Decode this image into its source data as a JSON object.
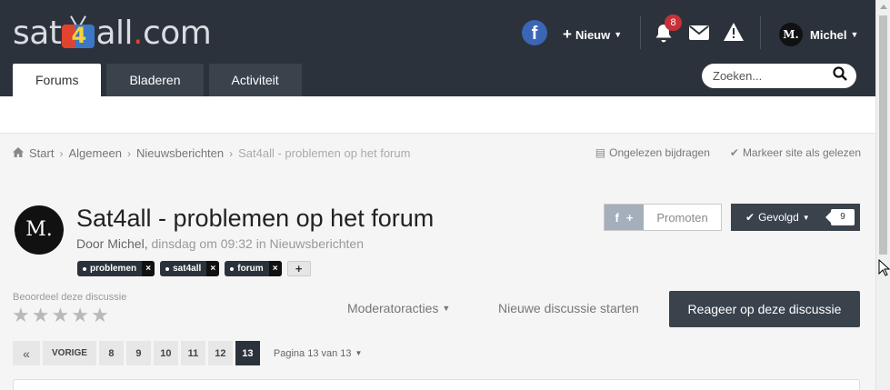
{
  "header": {
    "logo": {
      "part1": "sat",
      "part2": "all",
      "dot": ".",
      "part3": "com",
      "tv_digit": "4"
    },
    "facebook_icon": "f",
    "new_label": "Nieuw",
    "notification_count": "8",
    "user_initials": "M.",
    "user_name": "Michel",
    "search_placeholder": "Zoeken..."
  },
  "nav": {
    "tabs": [
      {
        "label": "Forums",
        "active": true
      },
      {
        "label": "Bladeren",
        "active": false
      },
      {
        "label": "Activiteit",
        "active": false
      }
    ]
  },
  "breadcrumb": {
    "items": [
      "Start",
      "Algemeen",
      "Nieuwsberichten",
      "Sat4all - problemen op het forum"
    ]
  },
  "breadcrumb_actions": {
    "unread": "Ongelezen bijdragen",
    "mark_read": "Markeer site als gelezen"
  },
  "topic": {
    "avatar_initials": "M.",
    "title": "Sat4all - problemen op het forum",
    "by_prefix": "Door",
    "author": "Michel",
    "comma": ",",
    "date": "dinsdag om 09:32",
    "in": "in",
    "forum": "Nieuwsberichten",
    "tags": [
      "problemen",
      "sat4all",
      "forum"
    ],
    "tag_remove": "×",
    "tag_add": "+"
  },
  "promote": {
    "label": "Promoten",
    "f": "f",
    "plus": "+"
  },
  "follow": {
    "label": "Gevolgd",
    "count": "9"
  },
  "rating": {
    "label": "Beoordeel deze discussie",
    "stars": 5,
    "value": 0
  },
  "actions": {
    "moderator": "Moderatoracties",
    "new_topic": "Nieuwe discussie starten",
    "reply": "Reageer op deze discussie"
  },
  "pagination": {
    "first": "«",
    "prev": "VORIGE",
    "pages": [
      "8",
      "9",
      "10",
      "11",
      "12",
      "13"
    ],
    "current": "13",
    "info": "Pagina 13 van 13"
  },
  "colors": {
    "header_bg": "#2b323b",
    "dark_button": "#3a424c",
    "badge": "#c8303a",
    "facebook": "#3b66b5"
  }
}
